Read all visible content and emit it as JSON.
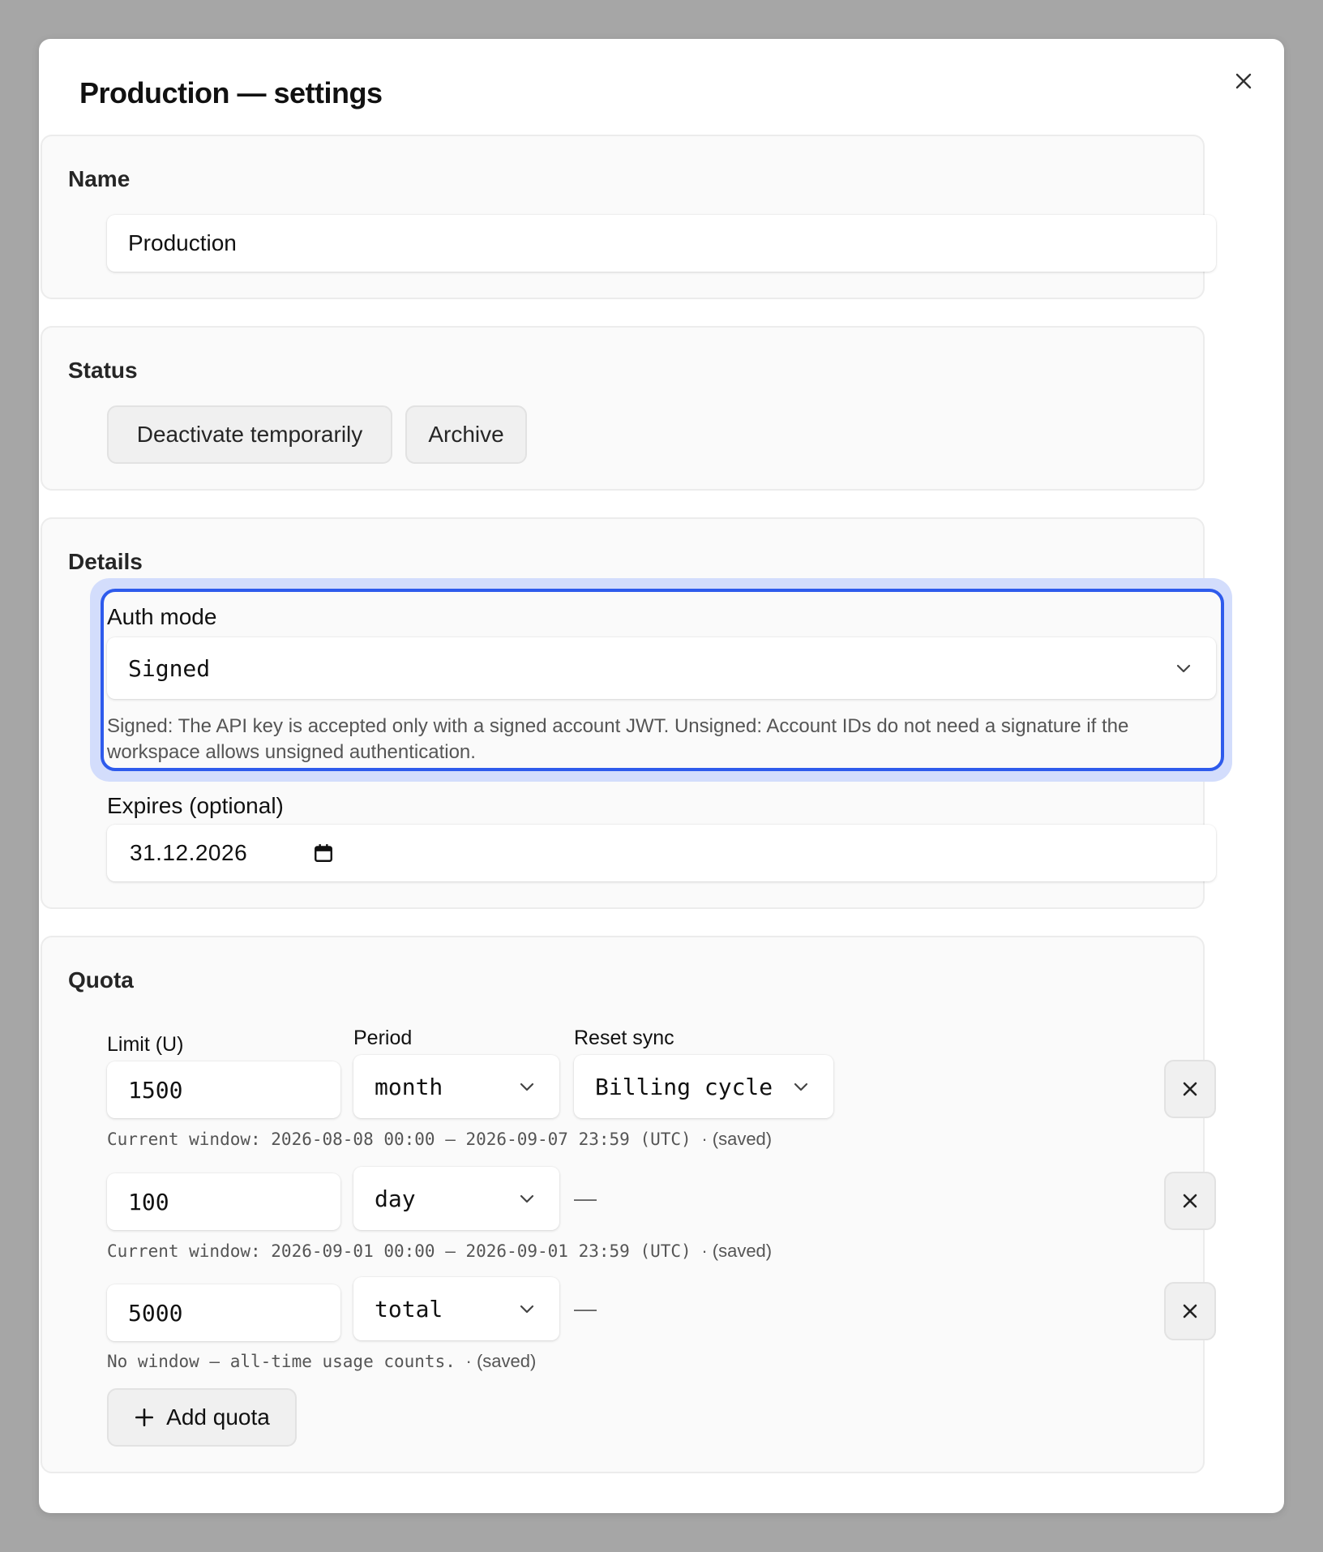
{
  "dialog": {
    "title": "Production — settings",
    "close_icon": "close-icon"
  },
  "name_section": {
    "title": "Name",
    "value": "Production"
  },
  "status_section": {
    "title": "Status",
    "deactivate_label": "Deactivate temporarily",
    "archive_label": "Archive"
  },
  "details_section": {
    "title": "Details",
    "auth_mode": {
      "label": "Auth mode",
      "value": "Signed",
      "help": "Signed: The API key is accepted only with a signed account JWT. Unsigned: Account IDs do not need a signature if the workspace allows unsigned authentication."
    },
    "expires": {
      "label": "Expires (optional)",
      "value": "31.12.2026",
      "icon": "calendar-icon"
    }
  },
  "quota_section": {
    "title": "Quota",
    "headers": {
      "limit": "Limit (U)",
      "period": "Period",
      "reset_sync": "Reset sync"
    },
    "rows": [
      {
        "limit": "1500",
        "period": "month",
        "reset_sync": "Billing cycle",
        "note": "Current window: 2026-08-08 00:00 – 2026-09-07 23:59 (UTC)",
        "saved": "· (saved)"
      },
      {
        "limit": "100",
        "period": "day",
        "reset_sync": "—",
        "note": "Current window: 2026-09-01 00:00 – 2026-09-01 23:59 (UTC)",
        "saved": "· (saved)"
      },
      {
        "limit": "5000",
        "period": "total",
        "reset_sync": "—",
        "note": "No window — all-time usage counts.",
        "saved": "· (saved)"
      }
    ],
    "add_label": "Add quota",
    "add_icon": "plus-icon",
    "remove_icon": "close-icon"
  },
  "colors": {
    "backdrop": "#a6a6a6",
    "focus": "#2e5bec",
    "focus_glow": "#d3ddfc",
    "card_bg": "#fafafa"
  }
}
